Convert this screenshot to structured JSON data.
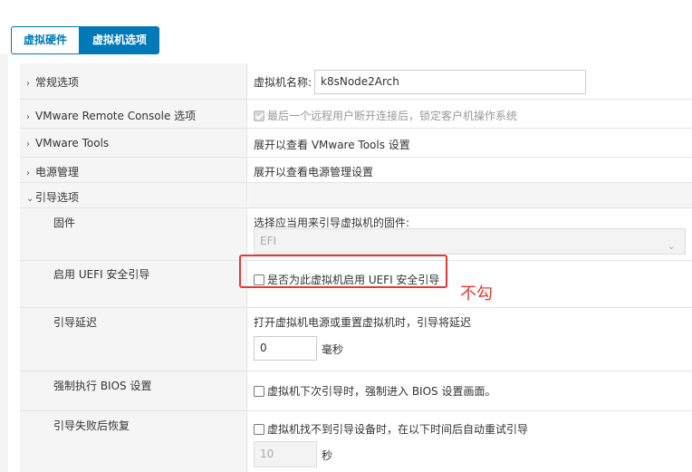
{
  "tabs": [
    {
      "label": "虚拟硬件",
      "active": false
    },
    {
      "label": "虚拟机选项",
      "active": true
    }
  ],
  "rows": {
    "general": {
      "label": "常规选项",
      "field_label": "虚拟机名称:",
      "vm_name": "k8sNode2Arch"
    },
    "vmrc": {
      "label": "VMware Remote Console 选项",
      "checkbox_text": "最后一个远程用户断开连接后，锁定客户机操作系统"
    },
    "tools": {
      "label": "VMware Tools",
      "text": "展开以查看 VMware Tools 设置"
    },
    "power": {
      "label": "电源管理",
      "text": "展开以查看电源管理设置"
    },
    "boot": {
      "label": "引导选项"
    },
    "firmware": {
      "label": "固件",
      "text": "选择应当用来引导虚拟机的固件:",
      "select_value": "EFI"
    },
    "uefi": {
      "label": "启用 UEFI 安全引导",
      "checkbox_text": "是否为此虚拟机启用 UEFI 安全引导"
    },
    "delay": {
      "label": "引导延迟",
      "text": "打开虚拟机电源或重置虚拟机时，引导将延迟",
      "value": "0",
      "unit": "毫秒"
    },
    "bios": {
      "label": "强制执行 BIOS 设置",
      "checkbox_text": "虚拟机下次引导时，强制进入 BIOS 设置画面。"
    },
    "retry": {
      "label": "引导失败后恢复",
      "checkbox_text": "虚拟机找不到引导设备时，在以下时间后自动重试引导",
      "value": "10",
      "unit": "秒"
    }
  },
  "annotation": {
    "text": "不勾",
    "color": "#e53935"
  },
  "colors": {
    "accent": "#0079b8"
  }
}
